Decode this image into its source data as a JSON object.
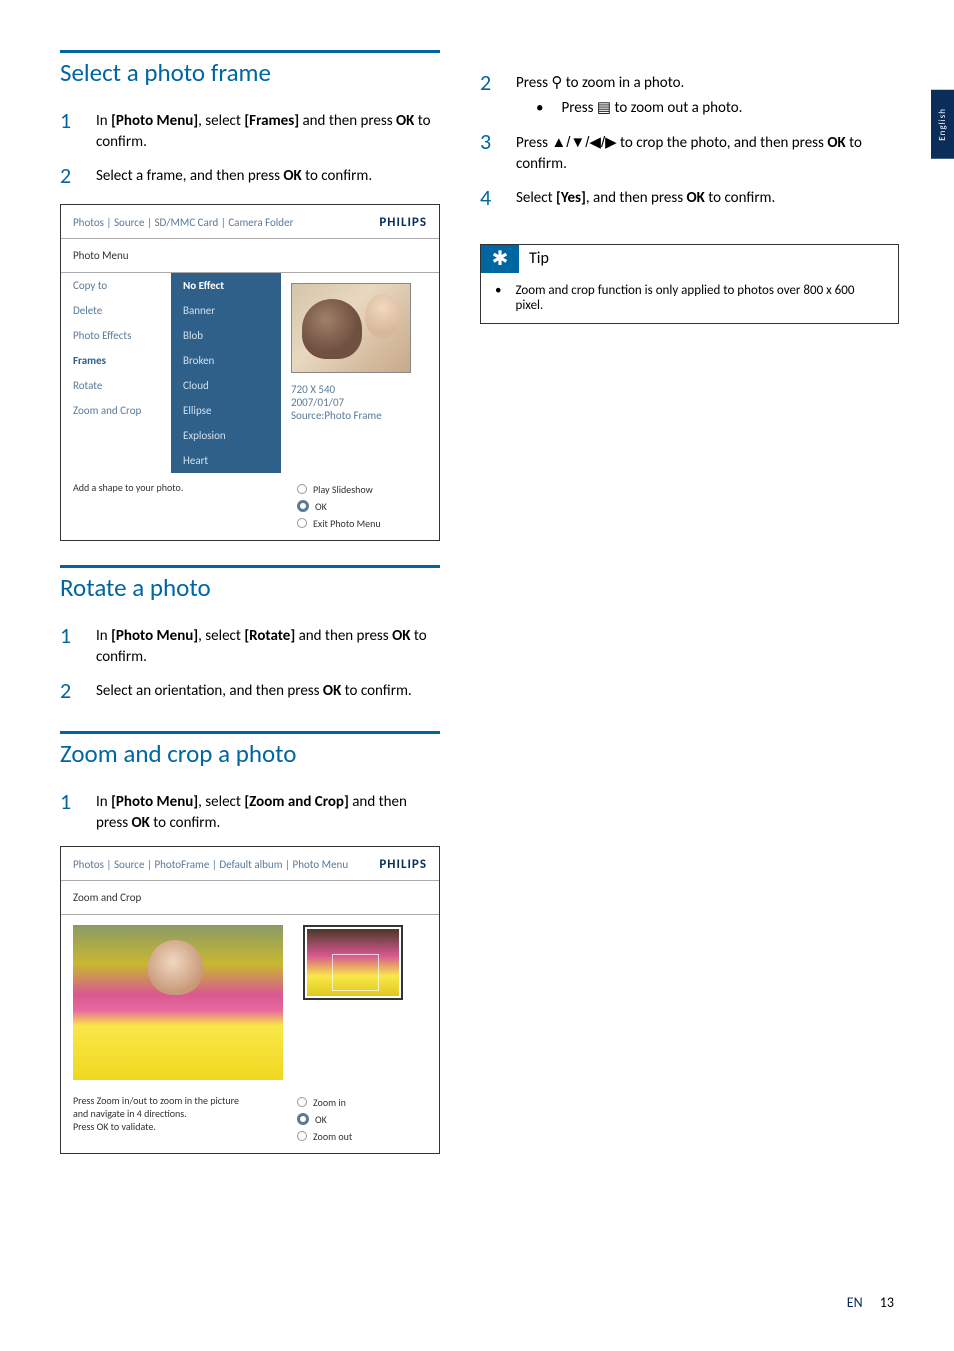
{
  "language_tab": "English",
  "section1": {
    "title": "Select a photo frame",
    "steps": [
      {
        "pre": "In ",
        "b1": "[Photo Menu]",
        "mid": ", select ",
        "b2": "[Frames]",
        "post": " and then press ",
        "b3": "OK",
        "end": " to confirm."
      },
      {
        "pre": "Select a frame, and then press ",
        "b1": "OK",
        "post": " to confirm."
      }
    ]
  },
  "screenshot1": {
    "breadcrumb": "Photos | Source | SD/MMC Card | Camera Folder",
    "brand": "PHILIPS",
    "menu_title": "Photo Menu",
    "col1": [
      "Copy to",
      "Delete",
      "Photo Effects",
      "Frames",
      "Rotate",
      "Zoom and Crop"
    ],
    "col1_selected": "Frames",
    "col2": [
      "No Effect",
      "Banner",
      "Blob",
      "Broken",
      "Cloud",
      "Ellipse",
      "Explosion",
      "Heart"
    ],
    "col2_selected": "No Effect",
    "meta": [
      "720 X 540",
      "2007/01/07",
      "Source:Photo Frame"
    ],
    "hint": "Add a shape to your photo.",
    "buttons": [
      "Play Slideshow",
      "OK",
      "Exit Photo Menu"
    ],
    "button_selected": "OK"
  },
  "section2": {
    "title": "Rotate a photo",
    "steps": [
      {
        "pre": "In ",
        "b1": "[Photo Menu]",
        "mid": ", select ",
        "b2": "[Rotate]",
        "post": " and then press ",
        "b3": "OK",
        "end": " to confirm."
      },
      {
        "pre": "Select an orientation, and then press ",
        "b1": "OK",
        "post": " to confirm."
      }
    ]
  },
  "section3": {
    "title": "Zoom and crop a photo",
    "steps": [
      {
        "pre": "In ",
        "b1": "[Photo Menu]",
        "mid": ", select ",
        "b2": "[Zoom and Crop]",
        "post": " and then press ",
        "b3": "OK",
        "end": " to confirm."
      }
    ]
  },
  "screenshot2": {
    "breadcrumb": "Photos | Source | PhotoFrame | Default album | Photo Menu",
    "brand": "PHILIPS",
    "menu_title": "Zoom and Crop",
    "hint1": "Press Zoom in/out to zoom in the picture",
    "hint2": "and navigate in 4 directions.",
    "hint3": "Press OK to validate.",
    "buttons": [
      "Zoom in",
      "OK",
      "Zoom out"
    ],
    "button_selected": "OK"
  },
  "right_steps": {
    "step2": {
      "pre": "Press ",
      "icon": "⚲",
      "post": " to zoom in a photo."
    },
    "step2_sub": {
      "pre": "Press ",
      "icon": "▤",
      "post": " to zoom out a photo."
    },
    "step3": {
      "pre": "Press ",
      "arrows": "▲/▼/◀/▶",
      "mid": " to crop the photo, and then press ",
      "b1": "OK",
      "post": " to confirm."
    },
    "step4": {
      "pre": "Select ",
      "b1": "[Yes]",
      "mid": ", and then press ",
      "b2": "OK",
      "post": " to confirm."
    }
  },
  "tip": {
    "label": "Tip",
    "body": "Zoom and crop function is only applied to photos over 800 x 600 pixel."
  },
  "footer": {
    "lang": "EN",
    "page": "13"
  }
}
